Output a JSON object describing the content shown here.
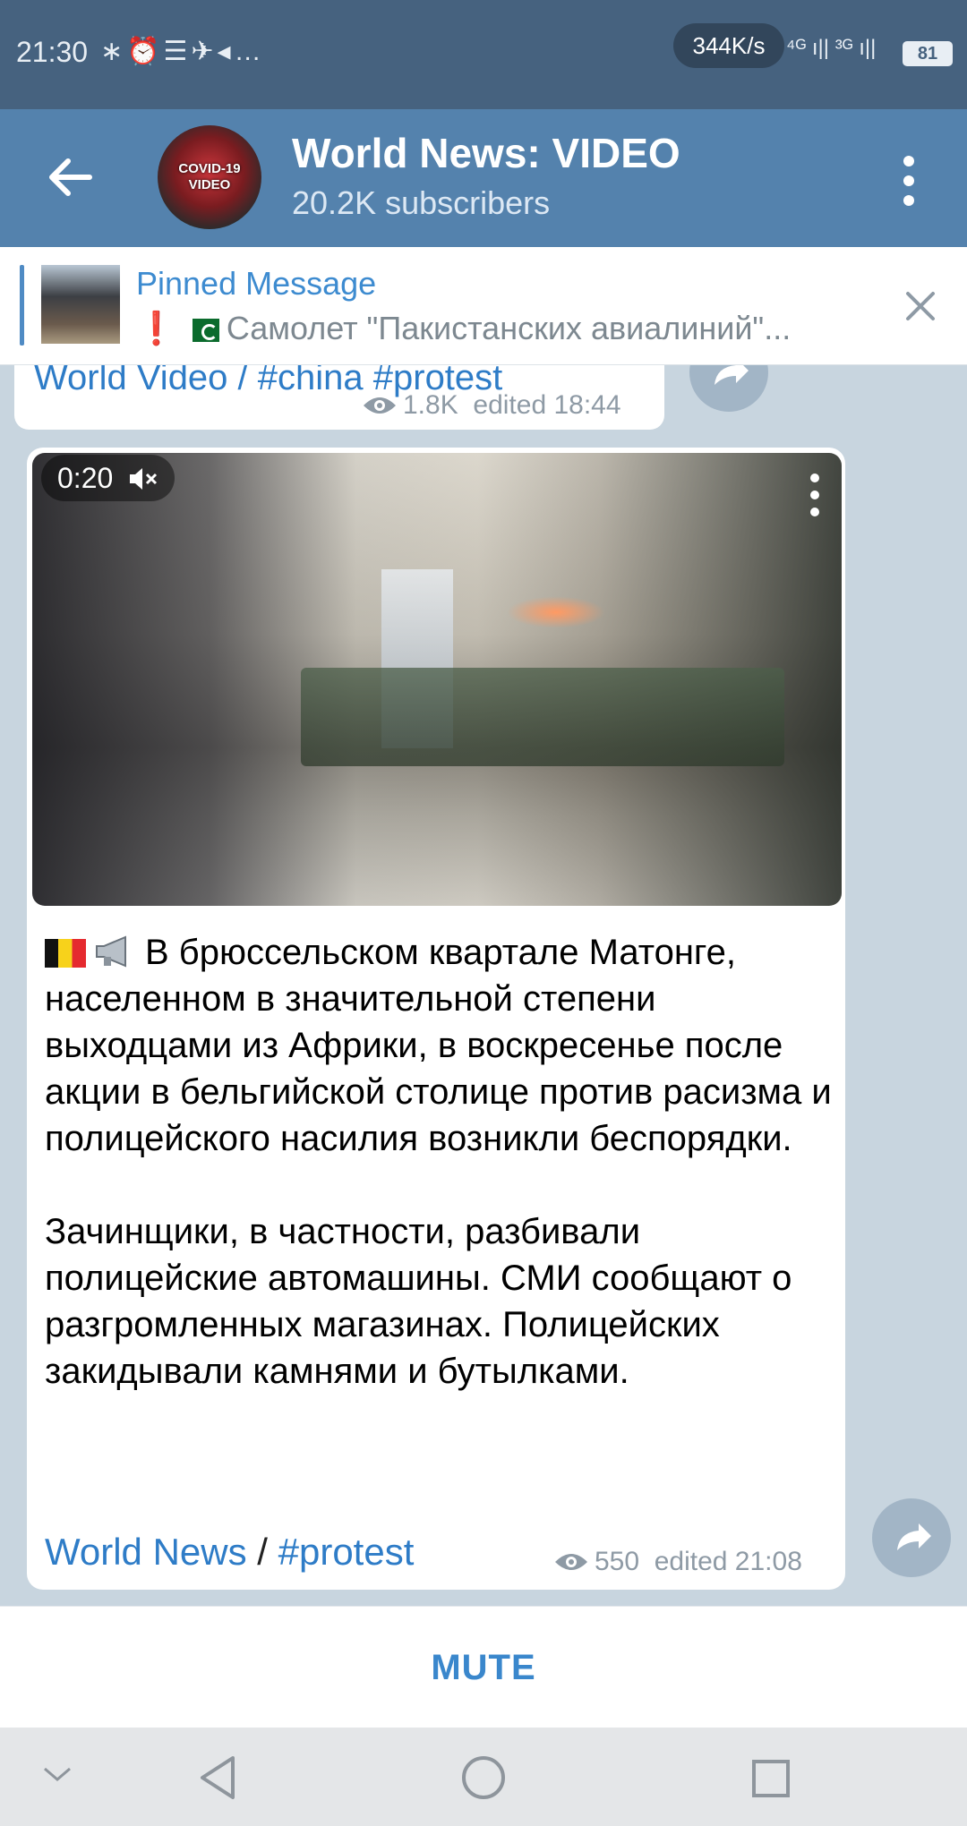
{
  "status_bar": {
    "time": "21:30",
    "icons_text": "∗⏰☰✈◂…",
    "speed": "344K/s",
    "network": "⁴ᴳ ı|| ³ᴳ ı||",
    "battery": "81"
  },
  "header": {
    "avatar_text": "COVID-19 VIDEO",
    "title": "World News: VIDEO",
    "subtitle": "20.2K subscribers"
  },
  "pinned": {
    "title": "Pinned Message",
    "exclamation": "❗",
    "text": "Самолет \"Пакистанских авиалиний\"..."
  },
  "previous_message": {
    "links": "World Video / #china #protest",
    "views": "1.8K",
    "edited": "edited 18:44"
  },
  "message": {
    "video_duration": "0:20",
    "paragraph1": "В брюссельском квартале Матонге, населенном в значительной степени выходцами из Африки, в воскресенье после акции в бельгийской столице против расизма и полицейского насилия возникли беспорядки.",
    "paragraph2": "Зачинщики, в частности, разбивали полицейские автомашины. СМИ сообщают о разгромленных магазинах. Полицейских закидывали камнями и бутылками.",
    "link1": "World News",
    "separator": "/",
    "link2": "#protest",
    "views": "550",
    "edited": "edited 21:08"
  },
  "bottom": {
    "mute_label": "MUTE"
  },
  "colors": {
    "status_bar": "#46627f",
    "header": "#5482ad",
    "link": "#2e7cc7",
    "chat_bg": "#c8d5df"
  }
}
